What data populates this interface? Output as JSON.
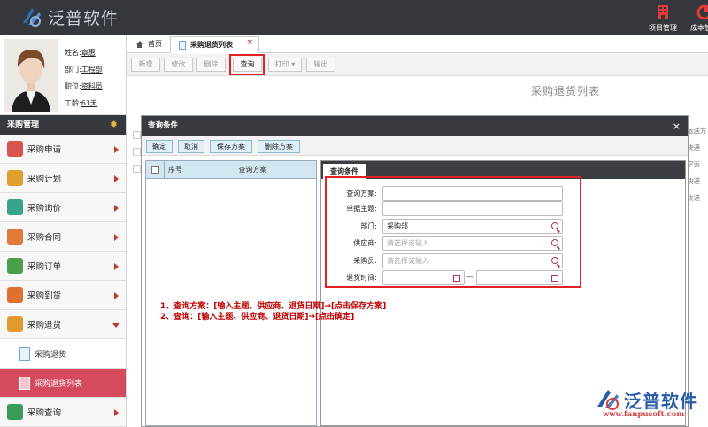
{
  "header": {
    "logo_text": "泛普软件",
    "icons": [
      {
        "label": "项目管理",
        "icon": "building-icon"
      },
      {
        "label": "成本管理",
        "icon": "pie-chart-icon"
      }
    ]
  },
  "profile": {
    "name_label": "姓名:",
    "name_value": "章惠",
    "dept_label": "部门:",
    "dept_value": "工程部",
    "title_label": "职位:",
    "title_value": "资料员",
    "age_label": "工龄:",
    "age_value": "63天"
  },
  "sidebar": {
    "title": "采购管理",
    "items": [
      {
        "label": "采购申请",
        "color": "#d9534f"
      },
      {
        "label": "采购计划",
        "color": "#e0a030"
      },
      {
        "label": "采购询价",
        "color": "#3aa38e"
      },
      {
        "label": "采购合同",
        "color": "#e07a3a"
      },
      {
        "label": "采购订单",
        "color": "#4aa04a"
      },
      {
        "label": "采购到货",
        "color": "#e07030"
      },
      {
        "label": "采购退货",
        "color": "#e09a30"
      }
    ],
    "sub_items": [
      {
        "label": "采购退货"
      },
      {
        "label": "采购退货列表"
      }
    ],
    "last_item": {
      "label": "采购查询",
      "color": "#3a9a5a"
    }
  },
  "tabs": {
    "home": "首页",
    "current": "采购退货列表",
    "close": "×"
  },
  "toolbar": {
    "new": "新增",
    "edit": "修改",
    "delete": "删除",
    "query": "查询",
    "print": "打印",
    "export": "输出"
  },
  "page_heading": "采购退货列表",
  "right_column": [
    "运送方",
    "快递",
    "空运",
    "快递",
    "快递"
  ],
  "dialog": {
    "title": "查询条件",
    "close": "×",
    "buttons": {
      "confirm": "确定",
      "cancel": "取消",
      "save_scheme": "保存方案",
      "delete_scheme": "删除方案"
    },
    "left_columns": {
      "seq": "序号",
      "scheme": "查询方案"
    },
    "right_tab": "查询条件",
    "form": {
      "scheme_label": "查询方案:",
      "scheme_value": "",
      "subject_label": "单据主题:",
      "subject_value": "",
      "dept_label": "部门:",
      "dept_value": "采购部",
      "supplier_label": "供应商:",
      "supplier_placeholder": "请选择或输入",
      "buyer_label": "采购员:",
      "buyer_placeholder": "请选择或输入",
      "date_label": "退货时间:",
      "date_sep": "—"
    }
  },
  "instructions": {
    "line1": "1、查询方案：[输入主题、供应商、退货日期]→[点击保存方案]",
    "line2": "2、查询：[输入主题、供应商、退货日期]→[点击确定]"
  },
  "watermark": {
    "text": "泛普软件",
    "url": "www.fanpusoft.com"
  }
}
